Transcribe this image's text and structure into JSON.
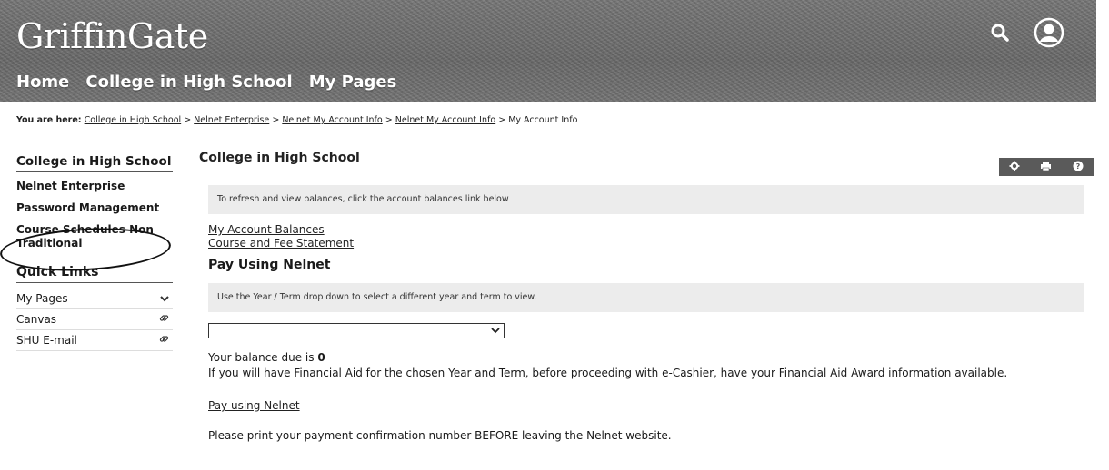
{
  "header": {
    "brand": "GriffinGate",
    "nav": [
      "Home",
      "College in High School",
      "My Pages"
    ],
    "icons": [
      "search-icon",
      "user-icon"
    ]
  },
  "breadcrumb": {
    "prefix": "You are here:",
    "items": [
      "College in High School",
      "Nelnet Enterprise",
      "Nelnet My Account Info",
      "Nelnet My Account Info"
    ],
    "current": "My Account Info",
    "separator": ">"
  },
  "sidebar": {
    "heading": "College in High School",
    "items": [
      "Nelnet Enterprise",
      "Password Management",
      "Course Schedules Non Traditional"
    ],
    "quick_links_heading": "Quick Links",
    "quick_links": [
      {
        "label": "My Pages",
        "icon": "chevron-down-icon"
      },
      {
        "label": "Canvas",
        "icon": "link-icon"
      },
      {
        "label": "SHU E-mail",
        "icon": "link-icon"
      }
    ]
  },
  "main": {
    "title": "College in High School",
    "tools": [
      "gear-icon",
      "print-icon",
      "help-icon"
    ],
    "refresh_info": "To refresh and view balances, click the account balances link below",
    "links": [
      "My Account Balances",
      "Course and Fee Statement"
    ],
    "pay_heading": "Pay Using Nelnet",
    "term_info": "Use the Year / Term drop down to select a different year and term to view.",
    "term_select": {
      "value": ""
    },
    "balance_text": "Your balance due is",
    "balance_value": "0",
    "financial_aid_text": "If you will have Financial Aid for the chosen Year and Term, before proceeding with e-Cashier, have your Financial Aid Award information available.",
    "pay_link": "Pay using Nelnet",
    "note": "Please print your payment confirmation number BEFORE leaving the Nelnet website."
  }
}
